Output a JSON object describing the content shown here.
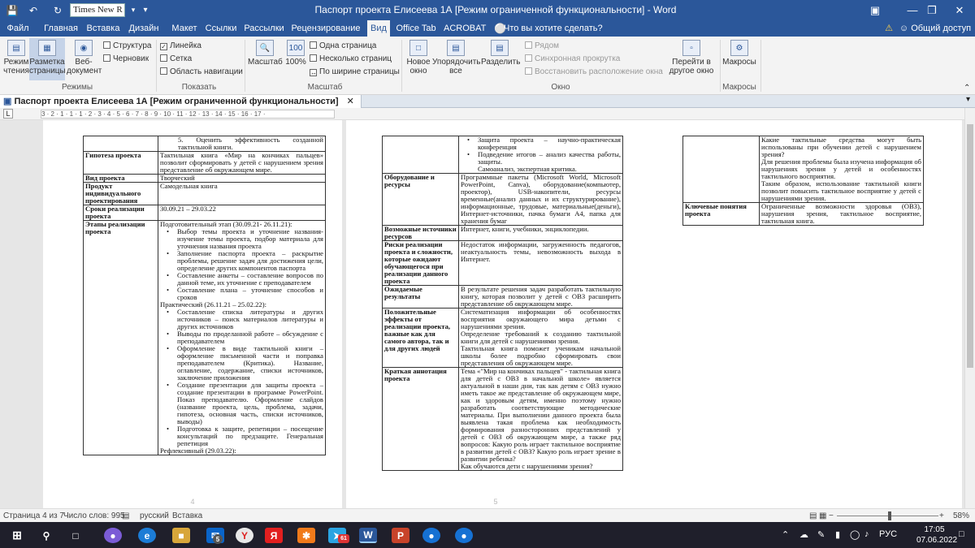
{
  "title_bar": {
    "font_box": "Times New R",
    "document_title": "Паспорт проекта Елисеева 1А [Режим ограниченной функциональности] - Word"
  },
  "tabs": [
    "Файл",
    "Главная",
    "Вставка",
    "Дизайн",
    "Макет",
    "Ссылки",
    "Рассылки",
    "Рецензирование",
    "Вид",
    "Office Tab",
    "ACROBAT",
    "Что вы хотите сделать?"
  ],
  "active_tab": "Вид",
  "alert_icon": "warning-icon",
  "share_label": "Общий доступ",
  "ribbon": {
    "modes": {
      "read": [
        "Режим",
        "чтения"
      ],
      "layout": [
        "Разметка",
        "страницы"
      ],
      "web": [
        "Веб-",
        "документ"
      ],
      "structure": "Структура",
      "draft": "Черновик",
      "group": "Режимы"
    },
    "show": {
      "ruler": "Линейка",
      "grid": "Сетка",
      "nav": "Область навигации",
      "group": "Показать"
    },
    "zoom": {
      "zoom": "Масштаб",
      "hundred": "100%",
      "one_page": "Одна страница",
      "multi": "Несколько страниц",
      "width": "По ширине страницы",
      "group": "Масштаб"
    },
    "window": {
      "new_window": [
        "Новое",
        "окно"
      ],
      "arrange": [
        "Упорядочить",
        "все"
      ],
      "split": "Разделить",
      "side": "Рядом",
      "sync": "Синхронная прокрутка",
      "reset": "Восстановить расположение окна",
      "switch": [
        "Перейти в",
        "другое окно"
      ],
      "group": "Окно"
    },
    "macros": {
      "label": "Макросы",
      "group": "Макросы"
    }
  },
  "doc_tab": "Паспорт проекта Елисеева 1А [Режим ограниченной функциональности]",
  "ruler_text": "3 · 2 · 1 · 1 · 1 · 2 · 3 · 4 · 5 · 6 · 7 · 8 · 9 · 10 · 11 · 12 · 13 · 14 · 15 · 16 · 17 ·",
  "pages": {
    "p1": {
      "r0": {
        "v": "5.  Оценить эффективность созданной тактильной книги."
      },
      "r1": {
        "k": "Гипотеза проекта",
        "v": "Тактильная книга «Мир на кончиках пальцев» позволит сформировать у детей с нарушением зрения представление об окружающем мире."
      },
      "r2": {
        "k": "Вид проекта",
        "v": "Творческий"
      },
      "r3": {
        "k": "Продукт индивидуального проектирования",
        "v": "Самодельная книга"
      },
      "r4": {
        "k": "Сроки реализации проекта",
        "v": "30.09.21 – 29.03.22"
      },
      "r5": {
        "k": "Этапы реализации проекта",
        "h1": "Подготовительный этап (30.09.21- 26.11.21):",
        "list1": [
          "Выбор темы проекта и уточнение названия-изучение темы проекта, подбор материала для уточнения названия проекта",
          "Заполнение паспорта проекта – раскрытие проблемы, решение задач для достижения цели, определение других компонентов паспорта",
          "Составление анкеты – составление вопросов по данной теме, их уточнение с преподавателем",
          "Составление плана – уточнение способов и сроков"
        ],
        "h2": "Практический (26.11.21 – 25.02.22):",
        "list2": [
          "Составление списка литературы и других источников – поиск материалов литературы и других источников",
          "Выводы по проделанной работе – обсуждение с преподавателем",
          "Оформление в виде тактильной книги – оформление письменной части и поправка преподавателем (Критика). Название, оглавление, содержание, списки источников, заключение приложения",
          "Создание презентации для защиты проекта – создание презентации в программе PowerPoint. Показ преподавателю. Оформление слайдов (название проекта, цель, проблема, задачи, гипотеза, основная часть, списки источников, выводы)",
          "Подготовка к защите, репетиции – посещение консультаций по предзащите. Генеральная репетиция"
        ],
        "h3": "Рефлексивный (29.03.22):"
      },
      "page_number": "4"
    },
    "p2": {
      "r0": {
        "list": [
          "Защита проекта – научно-практическая конференция",
          "Подведение итогов – анализ качества работы, защиты."
        ],
        "tail": "Самоанализ, экспертная критика."
      },
      "r1": {
        "k": "Оборудование и ресурсы",
        "v": "Программные пакеты (Microsoft World, Microsoft PowerPoint, Canva), оборудование(компьютер, проектор), USB-накопители, ресурсы временные(анализ данных и их структурирование), информационные, трудовые, материальные(деньги), Интернет-источники, пачка бумаги А4, папка для хранения бумаг"
      },
      "r2": {
        "k": "Возможные источники ресурсов",
        "v": "Интернет, книги, учебники, энциклопедии."
      },
      "r3": {
        "k": "Риски реализации проекта и сложности, которые ожидают обучающегося при реализации данного проекта",
        "v": "Недостаток информации, загруженность педагогов, неактуальность темы, невозможность выхода в Интернет."
      },
      "r4": {
        "k": "Ожидаемые результаты",
        "v": "В результате решения задач разработать тактильную книгу, которая позволит у детей с ОВЗ расширить представление об окружающем мире."
      },
      "r5": {
        "k": "Положительные эффекты от реализации проекта, важные как для самого автора, так и для других людей",
        "v1": "Систематизация информации об особенностях восприятия окружающего мира детьми с нарушениями зрения.",
        "v2": "Определение требований к созданию тактильной книги для детей с нарушениями зрения.",
        "v3": "Тактильная книга поможет ученикам начальной школы более подробно сформировать свои представления об окружающем мире."
      },
      "r6": {
        "k": "Краткая аннотация проекта",
        "v": "Тема «\"Мир на кончиках пальцев\" - тактильная книга для детей с ОВЗ в начальной школе» является актуальной в наши дни, так как детям с ОВЗ нужно иметь такое же представление об окружающем мире, как и здоровым детям, именно поэтому нужно разработать соответствующие методические материалы. При выполнении данного проекта была выявлена такая проблема как необходимость формирования разносторонних представлений у детей с ОВЗ об окружающем мире, а также ряд вопросов: Какую роль играет тактильное восприятие в развитии детей с ОВЗ? Какую роль играет зрение в развитии ребенка?",
        "v2": "Как обучаются дети с нарушениями зрения?"
      },
      "page_number": "5"
    },
    "p3": {
      "r0": {
        "v1": "Какие тактильные средства могут быть использованы при обучении детей с нарушением зрения?",
        "v2": "Для решения проблемы была изучена информация об нарушениях зрения у детей и особенностях тактильного восприятия.",
        "v3": "Таким образом, использование тактильной книги позволит повысить тактильное восприятие у детей с нарушениями зрения."
      },
      "r1": {
        "k": "Ключевые понятия проекта",
        "v": "Ограниченные возможности здоровья (ОВЗ), нарушения зрения, тактильное восприятие, тактильная книга."
      }
    }
  },
  "status": {
    "page": "Страница 4 из 7",
    "words": "Число слов: 995",
    "lang": "русский",
    "mode": "Вставка",
    "zoom": "58%"
  },
  "taskbar": {
    "lang": "РУС",
    "time": "17:05",
    "date": "07.06.2022",
    "badge_5": "5",
    "badge_61": "61"
  }
}
